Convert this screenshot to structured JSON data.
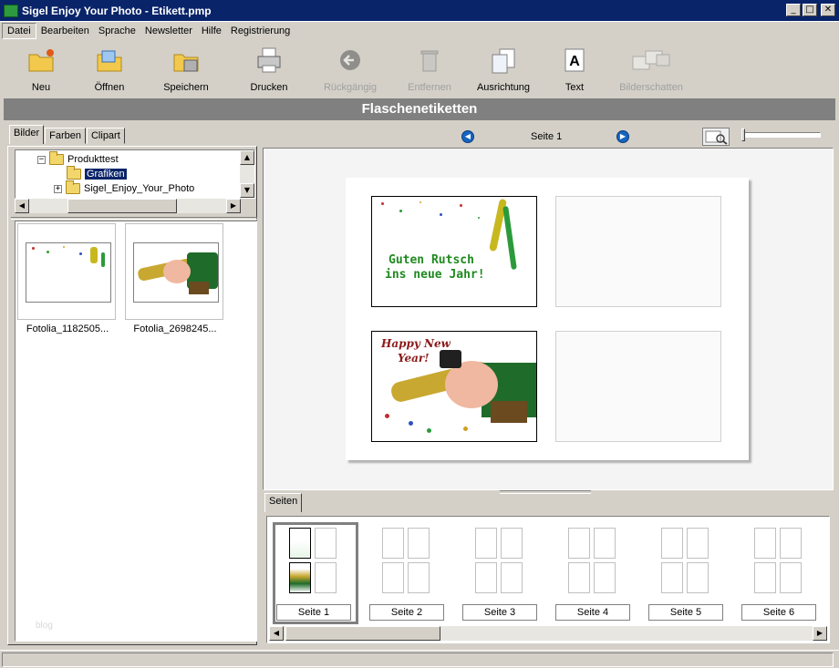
{
  "window": {
    "title": "Sigel Enjoy Your Photo - Etikett.pmp"
  },
  "menu": [
    "Datei",
    "Bearbeiten",
    "Sprache",
    "Newsletter",
    "Hilfe",
    "Registrierung"
  ],
  "toolbar": {
    "neu": "Neu",
    "oeffnen": "Öffnen",
    "speichern": "Speichern",
    "drucken": "Drucken",
    "rueckgaengig": "Rückgängig",
    "entfernen": "Entfernen",
    "ausrichtung": "Ausrichtung",
    "text": "Text",
    "bilderschatten": "Bilderschatten"
  },
  "banner": "Flaschenetiketten",
  "left_tabs": [
    "Bilder",
    "Farben",
    "Clipart"
  ],
  "tree": [
    "Produkttest",
    "Grafiken",
    "Sigel_Enjoy_Your_Photo"
  ],
  "images": [
    "Fotolia_1182505...",
    "Fotolia_2698245..."
  ],
  "watermark": "blog",
  "nav": {
    "page_label": "Seite 1"
  },
  "labels": {
    "card1_text1": "Guten Rutsch",
    "card1_text2": "ins neue Jahr!",
    "card2_text1": "Happy New",
    "card2_text2": "Year!"
  },
  "pages_tab": "Seiten",
  "pages": [
    "Seite 1",
    "Seite 2",
    "Seite 3",
    "Seite 4",
    "Seite 5",
    "Seite 6"
  ],
  "colors": {
    "titlebar": "#0a246a",
    "banner": "#808080",
    "label_green": "#1f8a1f",
    "label_red": "#8b1a1a"
  }
}
